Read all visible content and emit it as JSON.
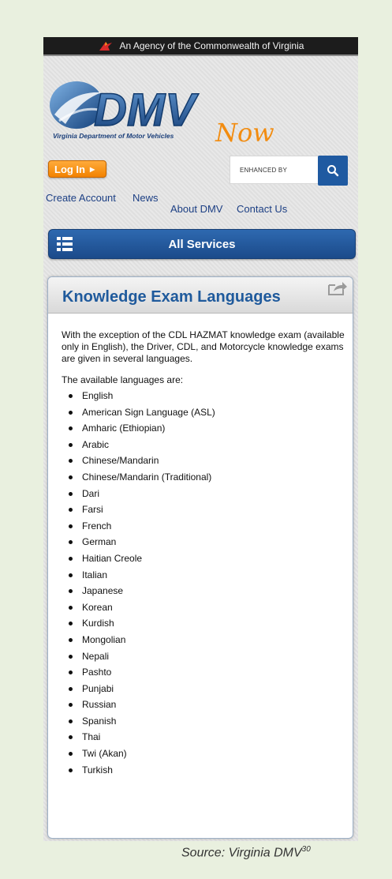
{
  "agency_bar": {
    "text": "An Agency of the Commonwealth of Virginia"
  },
  "logo": {
    "wordmark": "DMV",
    "now": "Now",
    "subtitle": "Virginia Department of Motor Vehicles"
  },
  "header": {
    "login_label": "Log In",
    "search_placeholder": "ENHANCED BY"
  },
  "nav": {
    "create_account": "Create Account",
    "news": "News",
    "about": "About DMV",
    "contact": "Contact Us"
  },
  "services": {
    "label": "All Services"
  },
  "page": {
    "title": "Knowledge Exam Languages",
    "intro": "With the exception of the CDL HAZMAT knowledge exam (available only in English), the Driver, CDL, and Motorcycle knowledge exams are given in several languages.",
    "available_label": "The available languages are:",
    "languages": [
      "English",
      "American Sign Language (ASL)",
      "Amharic (Ethiopian)",
      "Arabic",
      "Chinese/Mandarin",
      "Chinese/Mandarin (Traditional)",
      "Dari",
      "Farsi",
      "French",
      "German",
      "Haitian Creole",
      "Italian",
      "Japanese",
      "Korean",
      "Kurdish",
      "Mongolian",
      "Nepali",
      "Pashto",
      "Punjabi",
      "Russian",
      "Spanish",
      "Thai",
      "Twi (Akan)",
      "Turkish"
    ]
  },
  "source": {
    "text": "Source: Virginia DMV",
    "superscript": "30"
  },
  "colors": {
    "accent_blue": "#1f5aa1",
    "login_orange": "#f28200",
    "page_background": "#e9f0df"
  }
}
